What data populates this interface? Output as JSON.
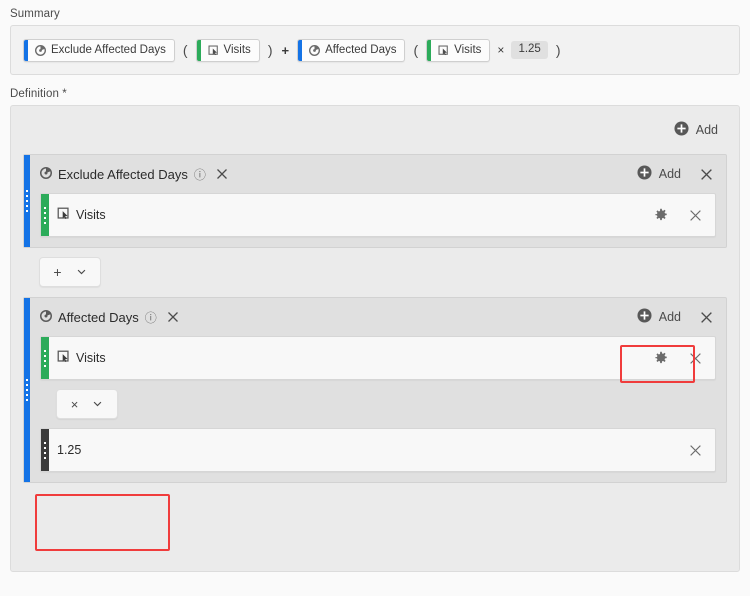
{
  "summary": {
    "label": "Summary",
    "formula": [
      {
        "kind": "pill",
        "name": "segment-pill-exclude-affected-days",
        "label": "Exclude Affected Days",
        "icon": "segment-icon",
        "edge": "blue"
      },
      {
        "kind": "paren",
        "name": "open-paren",
        "label": "("
      },
      {
        "kind": "pill",
        "name": "metric-pill-visits",
        "label": "Visits",
        "icon": "metric-icon",
        "edge": "green"
      },
      {
        "kind": "paren",
        "name": "close-paren",
        "label": ")"
      },
      {
        "kind": "op",
        "name": "operator-plus",
        "label": "+"
      },
      {
        "kind": "pill",
        "name": "segment-pill-affected-days",
        "label": "Affected Days",
        "icon": "segment-icon",
        "edge": "blue"
      },
      {
        "kind": "paren",
        "name": "open-paren",
        "label": "("
      },
      {
        "kind": "pill",
        "name": "metric-pill-visits",
        "label": "Visits",
        "icon": "metric-icon",
        "edge": "green"
      },
      {
        "kind": "optimes",
        "name": "operator-multiply",
        "label": "×"
      },
      {
        "kind": "static",
        "name": "static-value",
        "label": "1.25"
      },
      {
        "kind": "paren",
        "name": "close-paren",
        "label": ")"
      }
    ]
  },
  "definition": {
    "label": "Definition *",
    "add_label": "Add",
    "containers": [
      {
        "title": "Exclude Affected Days",
        "add_label": "Add",
        "rows": [
          {
            "type": "metric",
            "label": "Visits",
            "icon": "metric-icon",
            "rail": "green"
          }
        ],
        "operator": {
          "symbol": "+",
          "name": "operator-plus-dropdown"
        }
      },
      {
        "title": "Affected Days",
        "add_label": "Add",
        "rows": [
          {
            "type": "metric",
            "label": "Visits",
            "icon": "metric-icon",
            "rail": "green"
          }
        ],
        "operator": {
          "symbol": "×",
          "name": "operator-multiply-dropdown"
        },
        "value_row": {
          "type": "static",
          "label": "1.25",
          "rail": "dark"
        }
      }
    ]
  },
  "colors": {
    "segment_blue": "#1473e6",
    "metric_green": "#2cab5a",
    "static_dark": "#3b3b3b",
    "highlight_red": "#f03c3c"
  }
}
